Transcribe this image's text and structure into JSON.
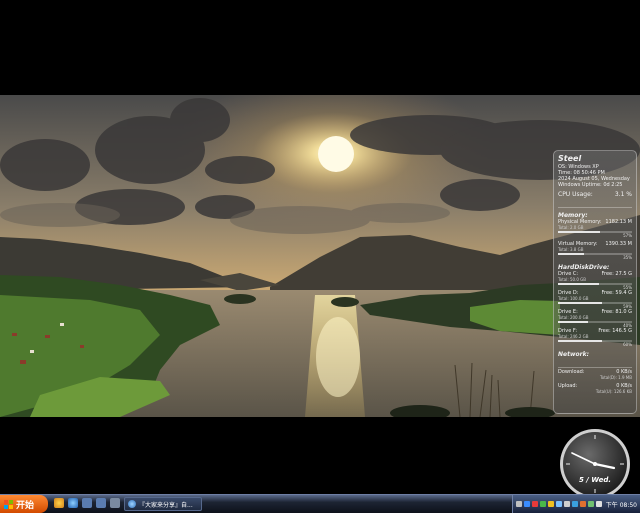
{
  "wallpaper": {
    "description_icon": "landscape-sunset-wallpaper"
  },
  "monitor": {
    "title": "Steel",
    "os": "OS: Windows XP",
    "time": "Time: 08 50:46 PM",
    "date": "2024 August 05, Wednesday",
    "uptime": "Windows Uptime: 0d 2:25",
    "cpu": {
      "label": "CPU Usage:",
      "value": "3.1 %",
      "fraction": 0.031
    },
    "memory_header": "Memory:",
    "physical": {
      "label": "Physical Memory:",
      "value": "1182.13 M",
      "total": "Total: 2.0 GB",
      "pct": "57%",
      "fraction": 0.57
    },
    "virtual": {
      "label": "Virtual Memory:",
      "value": "1390.33 M",
      "total": "Total: 3.8 GB",
      "pct": "35%",
      "fraction": 0.35
    },
    "disk_header": "HardDiskDrive:",
    "drives": [
      {
        "label": "Drive C:",
        "free": "Free: 27.5 G",
        "total": "Total: 50.0 GB",
        "pct": "55%",
        "fraction": 0.55
      },
      {
        "label": "Drive D:",
        "free": "Free: 59.4 G",
        "total": "Total: 100.0 GB",
        "pct": "59%",
        "fraction": 0.59
      },
      {
        "label": "Drive E:",
        "free": "Free: 81.0 G",
        "total": "Total: 200.0 GB",
        "pct": "40%",
        "fraction": 0.4
      },
      {
        "label": "Drive F:",
        "free": "Free: 146.5 G",
        "total": "Total: 246.2 GB",
        "pct": "60%",
        "fraction": 0.6
      }
    ],
    "network_header": "Network:",
    "download": {
      "label": "Download:",
      "value": "0 KB/s",
      "total": "Total(D): 1.9 MB"
    },
    "upload": {
      "label": "Upload:",
      "value": "0 KB/s",
      "total": "Total(U): 126.6 KB"
    }
  },
  "clock": {
    "date_text": "5 / Wed."
  },
  "taskbar": {
    "start_label": "开始",
    "more": "»",
    "task_label": "『大家来分享』自...",
    "time": "下午 08:50",
    "colors": {
      "start": "#e85f10",
      "bar": "#1d2433"
    }
  }
}
